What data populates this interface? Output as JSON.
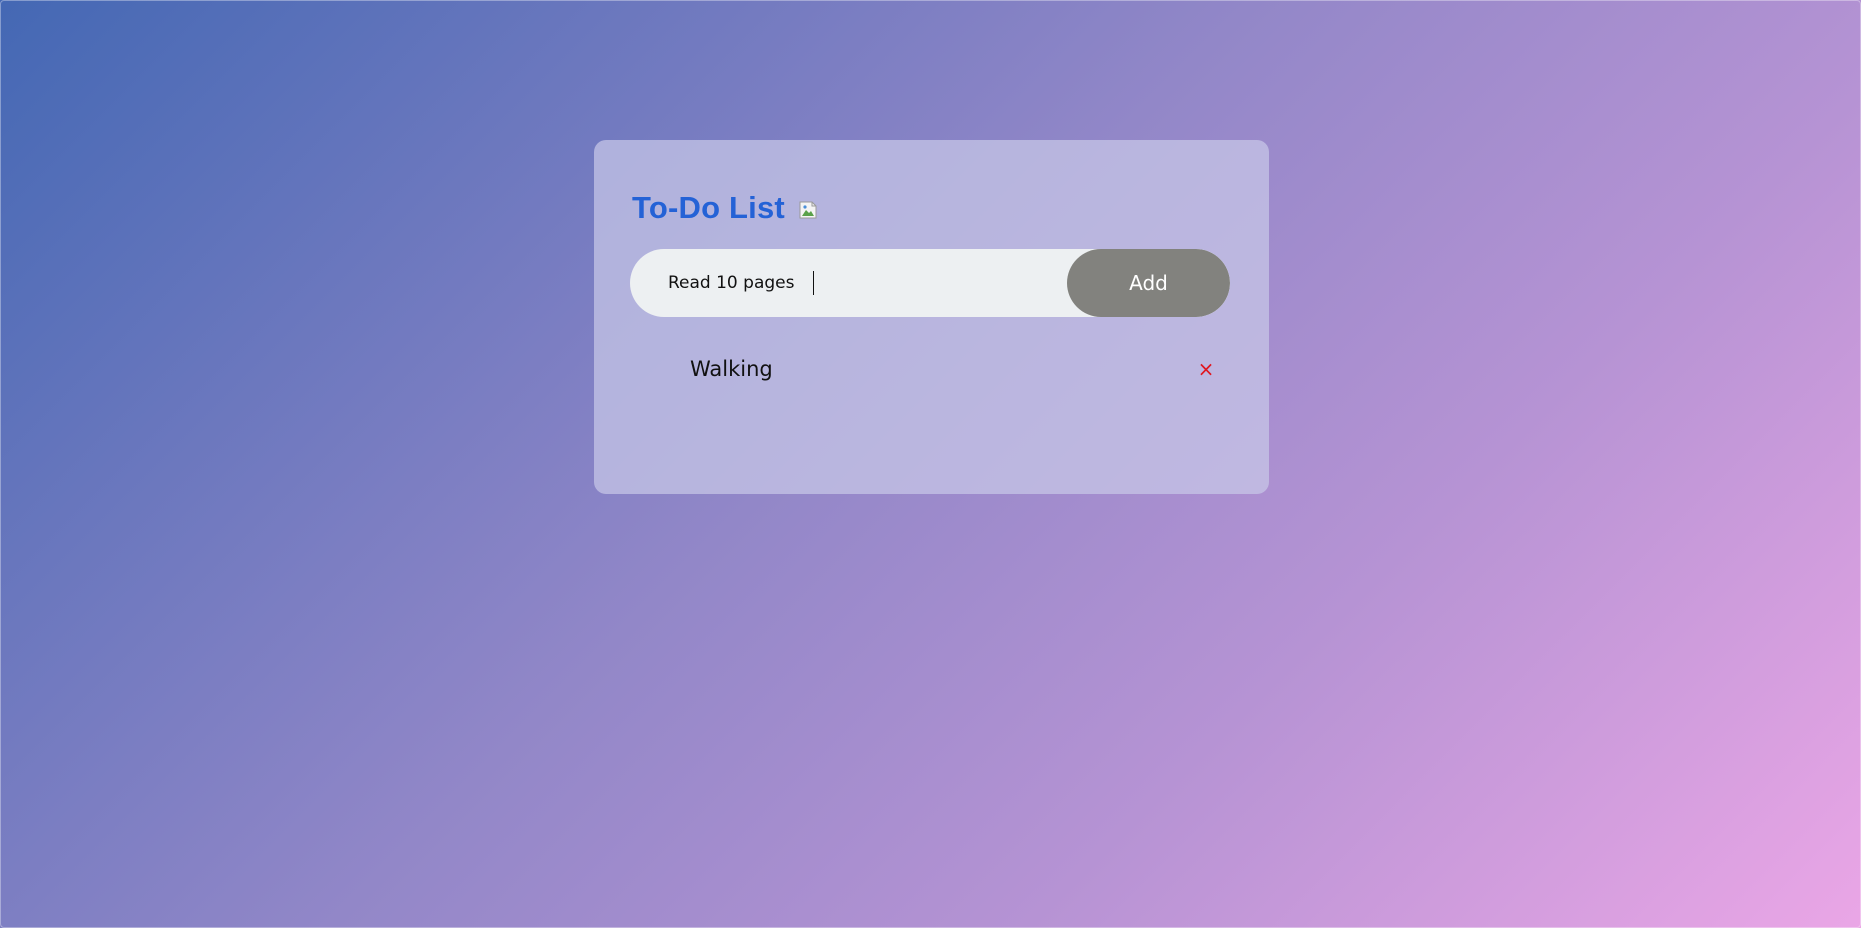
{
  "app": {
    "title": "To-Do List",
    "title_image_icon": "broken-image-icon"
  },
  "form": {
    "input_value": "Read 10 pages",
    "add_label": "Add"
  },
  "tasks": [
    {
      "label": "Walking",
      "delete_icon": "close-icon",
      "delete_glyph": "×"
    }
  ],
  "colors": {
    "title": "#2462d6",
    "add_button": "#82827e",
    "delete": "#e0161e",
    "input_bg": "#edf0f2",
    "gradient_start": "#4468b4",
    "gradient_end": "#eaa6e6"
  }
}
